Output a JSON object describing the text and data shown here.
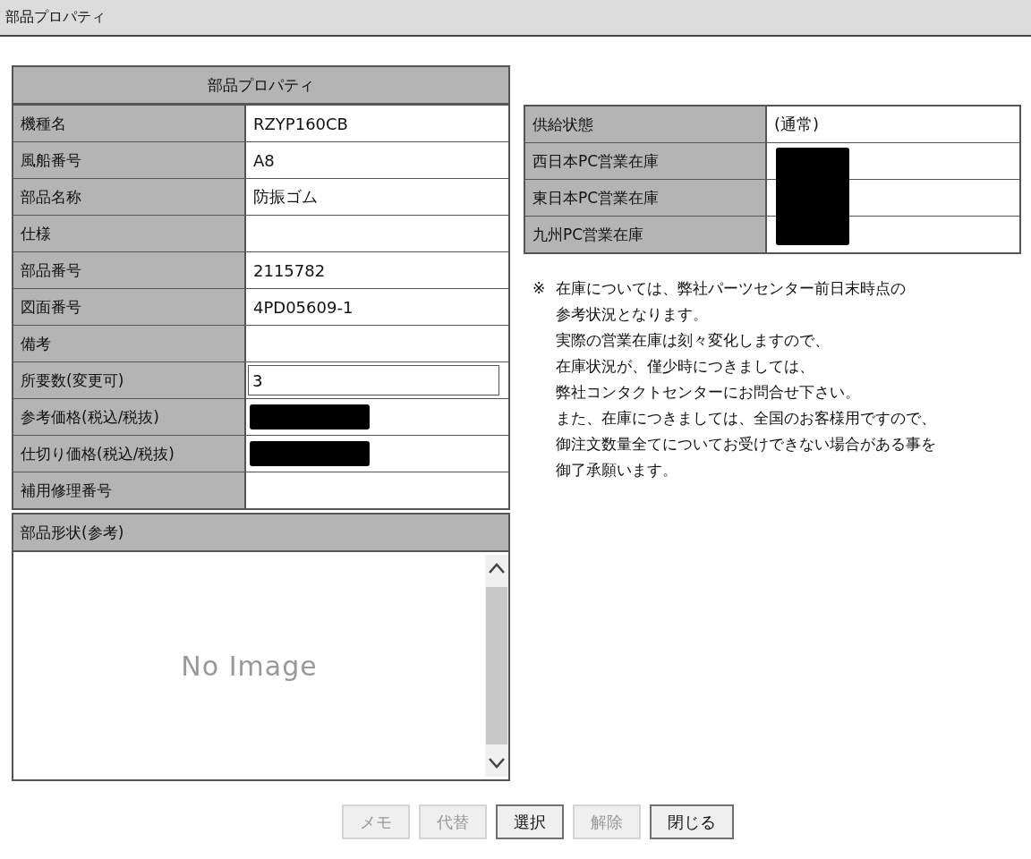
{
  "window": {
    "title": "部品プロパティ"
  },
  "properties": {
    "title": "部品プロパティ",
    "rows": [
      {
        "label": "機種名",
        "kind": "text",
        "value": "RZYP160CB"
      },
      {
        "label": "風船番号",
        "kind": "text",
        "value": "A8"
      },
      {
        "label": "部品名称",
        "kind": "text",
        "value": "防振ゴム"
      },
      {
        "label": "仕様",
        "kind": "empty"
      },
      {
        "label": "部品番号",
        "kind": "text",
        "value": "2115782"
      },
      {
        "label": "図面番号",
        "kind": "text",
        "value": "4PD05609-1"
      },
      {
        "label": "備考",
        "kind": "empty"
      },
      {
        "label": "所要数(変更可)",
        "kind": "input",
        "value": "3"
      },
      {
        "label": "参考価格(税込/税抜)",
        "kind": "redacted"
      },
      {
        "label": "仕切り価格(税込/税抜)",
        "kind": "redacted"
      },
      {
        "label": "補用修理番号",
        "kind": "empty"
      }
    ]
  },
  "shape": {
    "title": "部品形状(参考)",
    "placeholder_text": "No Image"
  },
  "stock": {
    "redacted": true,
    "rows": [
      {
        "label": "供給状態",
        "value": "(通常)"
      },
      {
        "label": "西日本PC営業在庫"
      },
      {
        "label": "東日本PC営業在庫"
      },
      {
        "label": "九州PC営業在庫"
      }
    ]
  },
  "note": {
    "mark": "※",
    "lines": [
      "在庫については、弊社パーツセンター前日末時点の",
      "参考状況となります。",
      "実際の営業在庫は刻々変化しますので、",
      "在庫状況が、僅少時につきましては、",
      "弊社コンタクトセンターにお問合せ下さい。",
      "また、在庫につきましては、全国のお客様用ですので、",
      "御注文数量全てについてお受けできない場合がある事を",
      "御了承願います。"
    ]
  },
  "buttons": [
    {
      "label": "メモ",
      "disabled": true
    },
    {
      "label": "代替",
      "disabled": true
    },
    {
      "label": "選択",
      "disabled": false
    },
    {
      "label": "解除",
      "disabled": true
    },
    {
      "label": "閉じる",
      "disabled": false
    }
  ]
}
